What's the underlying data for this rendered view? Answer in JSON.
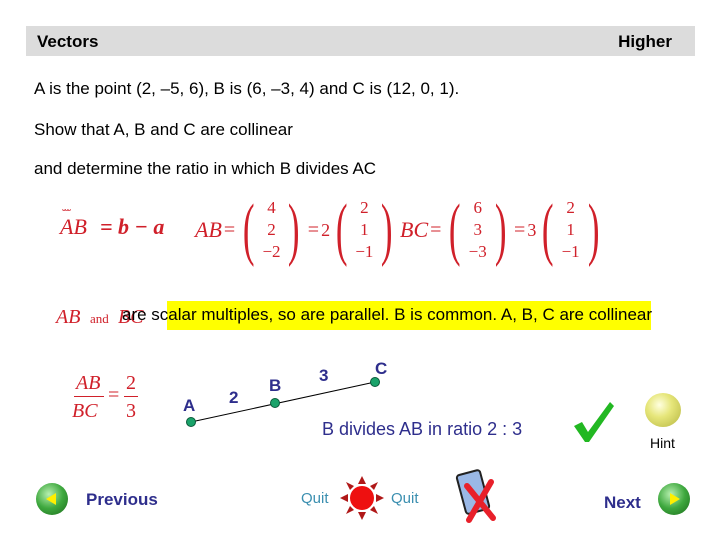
{
  "header": {
    "title": "Vectors",
    "level": "Higher"
  },
  "question": {
    "line1": "A is the point (2, –5, 6),  B is (6, –3, 4)  and  C is (12, 0, 1).",
    "line2": "Show that A, B and C are collinear",
    "line3": "and determine the ratio in which B divides AC"
  },
  "working": {
    "eq1": {
      "lhs": "AB",
      "rhs": "= b − a"
    },
    "eq2": {
      "lhs": "AB",
      "vector": [
        "4",
        "2",
        "−2"
      ],
      "scalar": "2",
      "unit": [
        "2",
        "1",
        "−1"
      ]
    },
    "eq3": {
      "lhs": "BC",
      "vector": [
        "6",
        "3",
        "−3"
      ],
      "scalar": "3",
      "unit": [
        "2",
        "1",
        "−1"
      ]
    },
    "conclusion_vec1": "AB",
    "conclusion_and": "and",
    "conclusion_vec2": "BC",
    "conclusion": "are scalar multiples, so are parallel.  B is common.  A, B, C are collinear",
    "ratio": {
      "num": "AB",
      "den": "BC",
      "num_val": "2",
      "den_val": "3"
    }
  },
  "diagram": {
    "points": [
      "A",
      "B",
      "C"
    ],
    "segment_labels": [
      "2",
      "3"
    ],
    "point_color": "#1aa36a"
  },
  "answer": "B divides AB in ratio 2 : 3",
  "nav": {
    "hint": "Hint",
    "previous": "Previous",
    "next": "Next",
    "quit_left": "Quit",
    "quit_right": "Quit"
  }
}
